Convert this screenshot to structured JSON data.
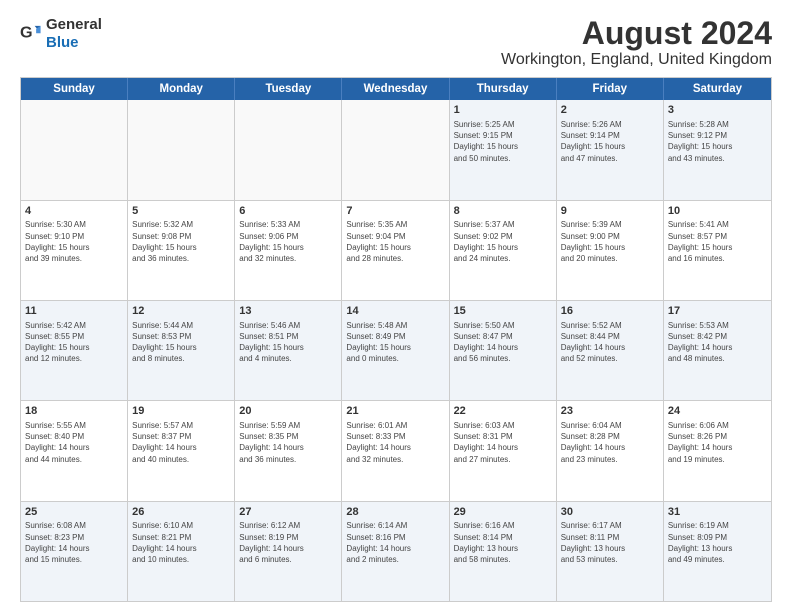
{
  "logo": {
    "general": "General",
    "blue": "Blue"
  },
  "title": "August 2024",
  "subtitle": "Workington, England, United Kingdom",
  "headers": [
    "Sunday",
    "Monday",
    "Tuesday",
    "Wednesday",
    "Thursday",
    "Friday",
    "Saturday"
  ],
  "weeks": [
    [
      {
        "day": "",
        "text": ""
      },
      {
        "day": "",
        "text": ""
      },
      {
        "day": "",
        "text": ""
      },
      {
        "day": "",
        "text": ""
      },
      {
        "day": "1",
        "text": "Sunrise: 5:25 AM\nSunset: 9:15 PM\nDaylight: 15 hours\nand 50 minutes."
      },
      {
        "day": "2",
        "text": "Sunrise: 5:26 AM\nSunset: 9:14 PM\nDaylight: 15 hours\nand 47 minutes."
      },
      {
        "day": "3",
        "text": "Sunrise: 5:28 AM\nSunset: 9:12 PM\nDaylight: 15 hours\nand 43 minutes."
      }
    ],
    [
      {
        "day": "4",
        "text": "Sunrise: 5:30 AM\nSunset: 9:10 PM\nDaylight: 15 hours\nand 39 minutes."
      },
      {
        "day": "5",
        "text": "Sunrise: 5:32 AM\nSunset: 9:08 PM\nDaylight: 15 hours\nand 36 minutes."
      },
      {
        "day": "6",
        "text": "Sunrise: 5:33 AM\nSunset: 9:06 PM\nDaylight: 15 hours\nand 32 minutes."
      },
      {
        "day": "7",
        "text": "Sunrise: 5:35 AM\nSunset: 9:04 PM\nDaylight: 15 hours\nand 28 minutes."
      },
      {
        "day": "8",
        "text": "Sunrise: 5:37 AM\nSunset: 9:02 PM\nDaylight: 15 hours\nand 24 minutes."
      },
      {
        "day": "9",
        "text": "Sunrise: 5:39 AM\nSunset: 9:00 PM\nDaylight: 15 hours\nand 20 minutes."
      },
      {
        "day": "10",
        "text": "Sunrise: 5:41 AM\nSunset: 8:57 PM\nDaylight: 15 hours\nand 16 minutes."
      }
    ],
    [
      {
        "day": "11",
        "text": "Sunrise: 5:42 AM\nSunset: 8:55 PM\nDaylight: 15 hours\nand 12 minutes."
      },
      {
        "day": "12",
        "text": "Sunrise: 5:44 AM\nSunset: 8:53 PM\nDaylight: 15 hours\nand 8 minutes."
      },
      {
        "day": "13",
        "text": "Sunrise: 5:46 AM\nSunset: 8:51 PM\nDaylight: 15 hours\nand 4 minutes."
      },
      {
        "day": "14",
        "text": "Sunrise: 5:48 AM\nSunset: 8:49 PM\nDaylight: 15 hours\nand 0 minutes."
      },
      {
        "day": "15",
        "text": "Sunrise: 5:50 AM\nSunset: 8:47 PM\nDaylight: 14 hours\nand 56 minutes."
      },
      {
        "day": "16",
        "text": "Sunrise: 5:52 AM\nSunset: 8:44 PM\nDaylight: 14 hours\nand 52 minutes."
      },
      {
        "day": "17",
        "text": "Sunrise: 5:53 AM\nSunset: 8:42 PM\nDaylight: 14 hours\nand 48 minutes."
      }
    ],
    [
      {
        "day": "18",
        "text": "Sunrise: 5:55 AM\nSunset: 8:40 PM\nDaylight: 14 hours\nand 44 minutes."
      },
      {
        "day": "19",
        "text": "Sunrise: 5:57 AM\nSunset: 8:37 PM\nDaylight: 14 hours\nand 40 minutes."
      },
      {
        "day": "20",
        "text": "Sunrise: 5:59 AM\nSunset: 8:35 PM\nDaylight: 14 hours\nand 36 minutes."
      },
      {
        "day": "21",
        "text": "Sunrise: 6:01 AM\nSunset: 8:33 PM\nDaylight: 14 hours\nand 32 minutes."
      },
      {
        "day": "22",
        "text": "Sunrise: 6:03 AM\nSunset: 8:31 PM\nDaylight: 14 hours\nand 27 minutes."
      },
      {
        "day": "23",
        "text": "Sunrise: 6:04 AM\nSunset: 8:28 PM\nDaylight: 14 hours\nand 23 minutes."
      },
      {
        "day": "24",
        "text": "Sunrise: 6:06 AM\nSunset: 8:26 PM\nDaylight: 14 hours\nand 19 minutes."
      }
    ],
    [
      {
        "day": "25",
        "text": "Sunrise: 6:08 AM\nSunset: 8:23 PM\nDaylight: 14 hours\nand 15 minutes."
      },
      {
        "day": "26",
        "text": "Sunrise: 6:10 AM\nSunset: 8:21 PM\nDaylight: 14 hours\nand 10 minutes."
      },
      {
        "day": "27",
        "text": "Sunrise: 6:12 AM\nSunset: 8:19 PM\nDaylight: 14 hours\nand 6 minutes."
      },
      {
        "day": "28",
        "text": "Sunrise: 6:14 AM\nSunset: 8:16 PM\nDaylight: 14 hours\nand 2 minutes."
      },
      {
        "day": "29",
        "text": "Sunrise: 6:16 AM\nSunset: 8:14 PM\nDaylight: 13 hours\nand 58 minutes."
      },
      {
        "day": "30",
        "text": "Sunrise: 6:17 AM\nSunset: 8:11 PM\nDaylight: 13 hours\nand 53 minutes."
      },
      {
        "day": "31",
        "text": "Sunrise: 6:19 AM\nSunset: 8:09 PM\nDaylight: 13 hours\nand 49 minutes."
      }
    ]
  ]
}
